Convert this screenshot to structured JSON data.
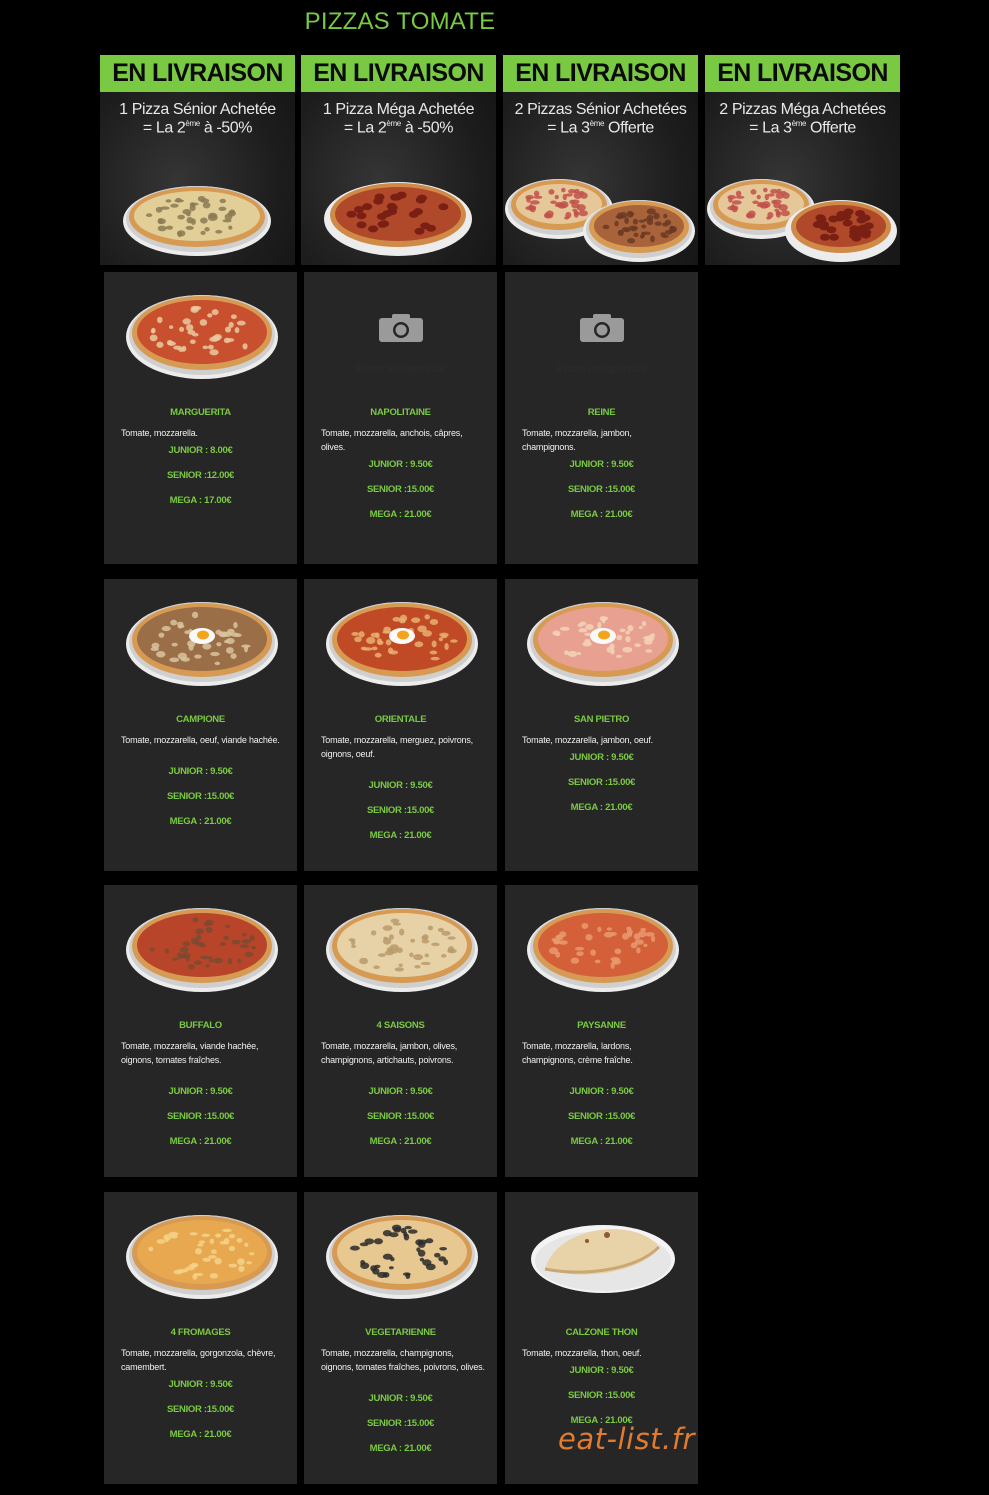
{
  "page": {
    "title": "PIZZAS TOMATE",
    "accent_color": "#7ac943",
    "background_color": "#000000",
    "card_color": "#262626"
  },
  "promos": [
    {
      "banner": "EN LIVRAISON",
      "line1": "1 Pizza Sénior Achetée",
      "line2_pre": "= La 2",
      "line2_sup": "ème",
      "line2_post": " à -50%",
      "image": "one-pizza"
    },
    {
      "banner": "EN LIVRAISON",
      "line1": "1 Pizza Méga Achetée",
      "line2_pre": "= La 2",
      "line2_sup": "ème",
      "line2_post": " à -50%",
      "image": "one-pizza-pepperoni"
    },
    {
      "banner": "EN LIVRAISON",
      "line1": "2 Pizzas Sénior Achetées",
      "line2_pre": "= La 3",
      "line2_sup": "ème",
      "line2_post": " Offerte",
      "image": "two-pizzas"
    },
    {
      "banner": "EN LIVRAISON",
      "line1": "2 Pizzas Méga Achetées",
      "line2_pre": "= La 3",
      "line2_sup": "ème",
      "line2_post": " Offerte",
      "image": "two-pizzas"
    }
  ],
  "unavailable_caption": "Photo indisponible",
  "pizzas": [
    {
      "name": "MARGUERITA",
      "desc": "Tomate, mozzarella.",
      "junior": "JUNIOR : 8.00€",
      "senior": "SENIOR :12.00€",
      "mega": "MEGA : 17.00€",
      "photo": "pizza",
      "sauce": "#c8502e",
      "top": "#e9c9a0"
    },
    {
      "name": "NAPOLITAINE",
      "desc": "Tomate, mozzarella, anchois, câpres, olives.",
      "junior": "JUNIOR : 9.50€",
      "senior": "SENIOR :15.00€",
      "mega": "MEGA : 21.00€",
      "photo": "unavailable"
    },
    {
      "name": "REINE",
      "desc": "Tomate, mozzarella, jambon, champignons.",
      "junior": "JUNIOR : 9.50€",
      "senior": "SENIOR :15.00€",
      "mega": "MEGA : 21.00€",
      "photo": "unavailable"
    },
    {
      "name": "CAMPIONE",
      "desc": "Tomate, mozzarella, oeuf, viande hachée.",
      "junior": "JUNIOR : 9.50€",
      "senior": "SENIOR :15.00€",
      "mega": "MEGA : 21.00€",
      "photo": "pizza-egg",
      "sauce": "#9a6e47",
      "top": "#d9c4a0"
    },
    {
      "name": "ORIENTALE",
      "desc": "Tomate, mozzarella, merguez, poivrons, oignons, oeuf.",
      "junior": "JUNIOR : 9.50€",
      "senior": "SENIOR :15.00€",
      "mega": "MEGA : 21.00€",
      "photo": "pizza-egg",
      "sauce": "#c04a25",
      "top": "#e8b070"
    },
    {
      "name": "SAN PIETRO",
      "desc": "Tomate, mozzarella, jambon, oeuf.",
      "junior": "JUNIOR : 9.50€",
      "senior": "SENIOR :15.00€",
      "mega": "MEGA : 21.00€",
      "photo": "pizza-egg",
      "sauce": "#e8a090",
      "top": "#f2d2b8"
    },
    {
      "name": "BUFFALO",
      "desc": "Tomate, mozzarella, viande hachée, oignons, tomates fraîches.",
      "junior": "JUNIOR : 9.50€",
      "senior": "SENIOR :15.00€",
      "mega": "MEGA : 21.00€",
      "photo": "pizza",
      "sauce": "#b8442a",
      "top": "#7a4a30"
    },
    {
      "name": "4 SAISONS",
      "desc": "Tomate, mozzarella, jambon, olives, champignons, artichauts, poivrons.",
      "junior": "JUNIOR : 9.50€",
      "senior": "SENIOR :15.00€",
      "mega": "MEGA : 21.00€",
      "photo": "pizza",
      "sauce": "#e6d2a6",
      "top": "#b89a6a"
    },
    {
      "name": "PAYSANNE",
      "desc": "Tomate, mozzarella, lardons, champignons, crème fraîche.",
      "junior": "JUNIOR : 9.50€",
      "senior": "SENIOR :15.00€",
      "mega": "MEGA : 21.00€",
      "photo": "pizza",
      "sauce": "#d4603a",
      "top": "#e89a70"
    },
    {
      "name": "4 FROMAGES",
      "desc": "Tomate, mozzarella, gorgonzola, chèvre, camembert.",
      "junior": "JUNIOR : 9.50€",
      "senior": "SENIOR :15.00€",
      "mega": "MEGA : 21.00€",
      "photo": "pizza",
      "sauce": "#e8a850",
      "top": "#f3d28a"
    },
    {
      "name": "VEGETARIENNE",
      "desc": "Tomate, mozzarella, champignons, oignons, tomates fraîches, poivrons, olives.",
      "junior": "JUNIOR : 9.50€",
      "senior": "SENIOR :15.00€",
      "mega": "MEGA : 21.00€",
      "photo": "pizza",
      "sauce": "#e6c890",
      "top": "#2a2a2a"
    },
    {
      "name": "CALZONE THON",
      "desc": "Tomate, mozzarella, thon, oeuf.",
      "junior": "JUNIOR : 9.50€",
      "senior": "SENIOR :15.00€",
      "mega": "MEGA : 21.00€",
      "photo": "calzone",
      "sauce": "#e8d2a8",
      "top": "#c89a60"
    }
  ],
  "watermark": "eat-list.fr"
}
